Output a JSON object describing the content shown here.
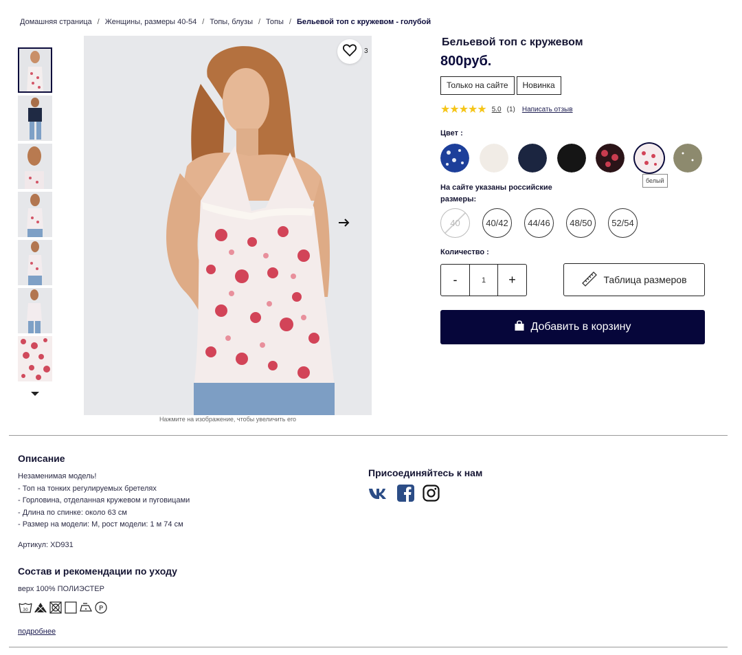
{
  "breadcrumb": {
    "items": [
      "Домашняя страница",
      "Женщины, размеры 40-54",
      "Топы, блузы",
      "Топы"
    ],
    "current": "Бельевой топ с кружевом - голубой",
    "separator": "/"
  },
  "gallery": {
    "wishlist_count": "3",
    "zoom_hint": "Нажмите на изображение, чтобы увеличить его"
  },
  "product": {
    "title": "Бельевой топ с кружевом",
    "price": "800руб.",
    "badges": [
      "Только на сайте",
      "Новинка"
    ],
    "rating": {
      "stars": "★★★★★",
      "score": "5.0",
      "count": "(1)",
      "write_review": "Написать отзыв"
    }
  },
  "colors": {
    "label": "Цвет :",
    "tooltip": "белый",
    "swatch_colors": [
      "#1d3f9a",
      "#f1ece6",
      "#1b2540",
      "#151515",
      "#3b1a22",
      "#f3e6ea",
      "#8d8a6e"
    ]
  },
  "sizes": {
    "label": "На сайте указаны российские размеры:",
    "options": [
      "40",
      "40/42",
      "44/46",
      "48/50",
      "52/54"
    ]
  },
  "quantity": {
    "label": "Количество :",
    "minus": "-",
    "value": "1",
    "plus": "+"
  },
  "actions": {
    "size_chart": "Таблица размеров",
    "add_to_cart": "Добавить в корзину"
  },
  "description": {
    "title": "Описание",
    "lines": [
      "Незаменимая модель!",
      "- Топ на тонких регулируемых бретелях",
      "- Горловина, отделанная кружевом и пуговицами",
      "- Длина по спинке: около 63 см",
      "- Размер на модели: M, рост модели: 1 м 74 см"
    ],
    "article": "Артикул: XD931"
  },
  "composition": {
    "title": "Состав и рекомендации по уходу",
    "text": "верх 100% ПОЛИЭСТЕР",
    "more": "подробнее"
  },
  "social": {
    "title": "Присоединяйтесь к нам"
  },
  "theme": {
    "navy": "#06063a",
    "star": "#f5c518"
  }
}
